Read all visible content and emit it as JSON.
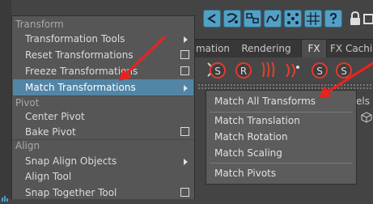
{
  "shelf": {
    "tabs": [
      {
        "label": "mation"
      },
      {
        "label": "Rendering"
      },
      {
        "label": "FX"
      },
      {
        "label": "FX Cachi"
      }
    ],
    "right_label": "els"
  },
  "menu": {
    "sections": {
      "transform": "Transform",
      "pivot": "Pivot",
      "align": "Align"
    },
    "items": [
      {
        "label": "Transformation Tools"
      },
      {
        "label": "Reset Transformations"
      },
      {
        "label": "Freeze Transformations"
      },
      {
        "label": "Match Transformations"
      },
      {
        "label": "Center Pivot"
      },
      {
        "label": "Bake Pivot"
      },
      {
        "label": "Snap Align Objects"
      },
      {
        "label": "Align Tool"
      },
      {
        "label": "Snap Together Tool"
      }
    ]
  },
  "submenu": {
    "items": [
      {
        "label": "Match All Transforms"
      },
      {
        "label": "Match Translation"
      },
      {
        "label": "Match Rotation"
      },
      {
        "label": "Match Scaling"
      },
      {
        "label": "Match Pivots"
      }
    ]
  },
  "colors": {
    "highlight": "#5285a6",
    "annotation_arrow": "#e8231f"
  }
}
